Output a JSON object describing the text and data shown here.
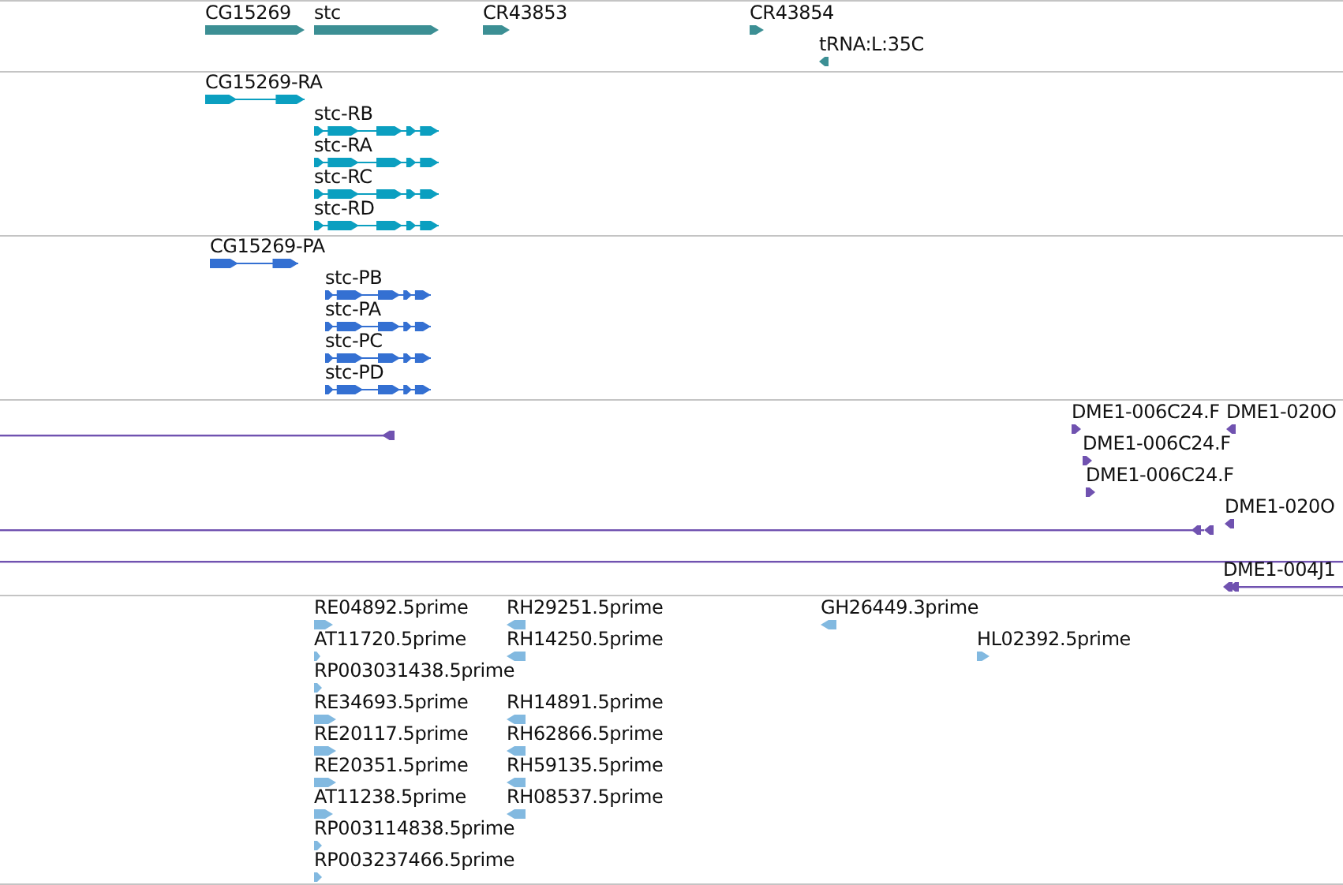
{
  "tracks": [
    {
      "kind": "gene",
      "color": "#3c8f94",
      "features": [
        {
          "label": "CG15269",
          "reverse": false
        },
        {
          "label": "stc",
          "reverse": false
        },
        {
          "label": "CR43853",
          "reverse": false
        },
        {
          "label": "CR43854",
          "reverse": false
        },
        {
          "label": "tRNA:L:35C",
          "reverse": true
        }
      ]
    },
    {
      "kind": "transcript",
      "color": "#0b9fc0",
      "features": [
        {
          "label": "CG15269-RA",
          "reverse": false
        },
        {
          "label": "stc-RB",
          "reverse": false
        },
        {
          "label": "stc-RA",
          "reverse": false
        },
        {
          "label": "stc-RC",
          "reverse": false
        },
        {
          "label": "stc-RD",
          "reverse": false
        }
      ]
    },
    {
      "kind": "transcript",
      "color": "#3470d2",
      "features": [
        {
          "label": "CG15269-PA",
          "reverse": false
        },
        {
          "label": "stc-PB",
          "reverse": false
        },
        {
          "label": "stc-PA",
          "reverse": false
        },
        {
          "label": "stc-PC",
          "reverse": false
        },
        {
          "label": "stc-PD",
          "reverse": false
        }
      ]
    },
    {
      "kind": "match",
      "color": "#7052b0",
      "features": [
        {
          "kind": "arrow",
          "reverse": true
        },
        {
          "kind": "arrow",
          "label": "DME1-006C24.F",
          "reverse": false
        },
        {
          "kind": "arrow",
          "label": "DME1-020O",
          "reverse": true
        },
        {
          "kind": "arrow",
          "label": "DME1-006C24.F",
          "reverse": false
        },
        {
          "kind": "arrow",
          "label": "DME1-006C24.F",
          "reverse": false
        },
        {
          "kind": "arrow",
          "reverse": true
        },
        {
          "kind": "arrow",
          "label": "DME1-020O",
          "reverse": true
        },
        {
          "kind": "line"
        },
        {
          "kind": "arrow",
          "label": "DME1-004J1",
          "reverse": true
        }
      ]
    },
    {
      "kind": "gene",
      "color": "#82b9e0",
      "features": [
        {
          "label": "RE04892.5prime",
          "reverse": false
        },
        {
          "label": "RH29251.5prime",
          "reverse": true
        },
        {
          "label": "GH26449.3prime",
          "reverse": true
        },
        {
          "label": "AT11720.5prime",
          "reverse": false
        },
        {
          "label": "RH14250.5prime",
          "reverse": true
        },
        {
          "label": "HL02392.5prime",
          "reverse": false
        },
        {
          "label": "RP003031438.5prime",
          "reverse": false
        },
        {
          "label": "RE34693.5prime",
          "reverse": false
        },
        {
          "label": "RH14891.5prime",
          "reverse": true
        },
        {
          "label": "RE20117.5prime",
          "reverse": false
        },
        {
          "label": "RH62866.5prime",
          "reverse": true
        },
        {
          "label": "RE20351.5prime",
          "reverse": false
        },
        {
          "label": "RH59135.5prime",
          "reverse": true
        },
        {
          "label": "AT11238.5prime",
          "reverse": false
        },
        {
          "label": "RH08537.5prime",
          "reverse": true
        },
        {
          "label": "RP003114838.5prime",
          "reverse": false
        },
        {
          "label": "RP003237466.5prime",
          "reverse": false
        }
      ]
    }
  ]
}
